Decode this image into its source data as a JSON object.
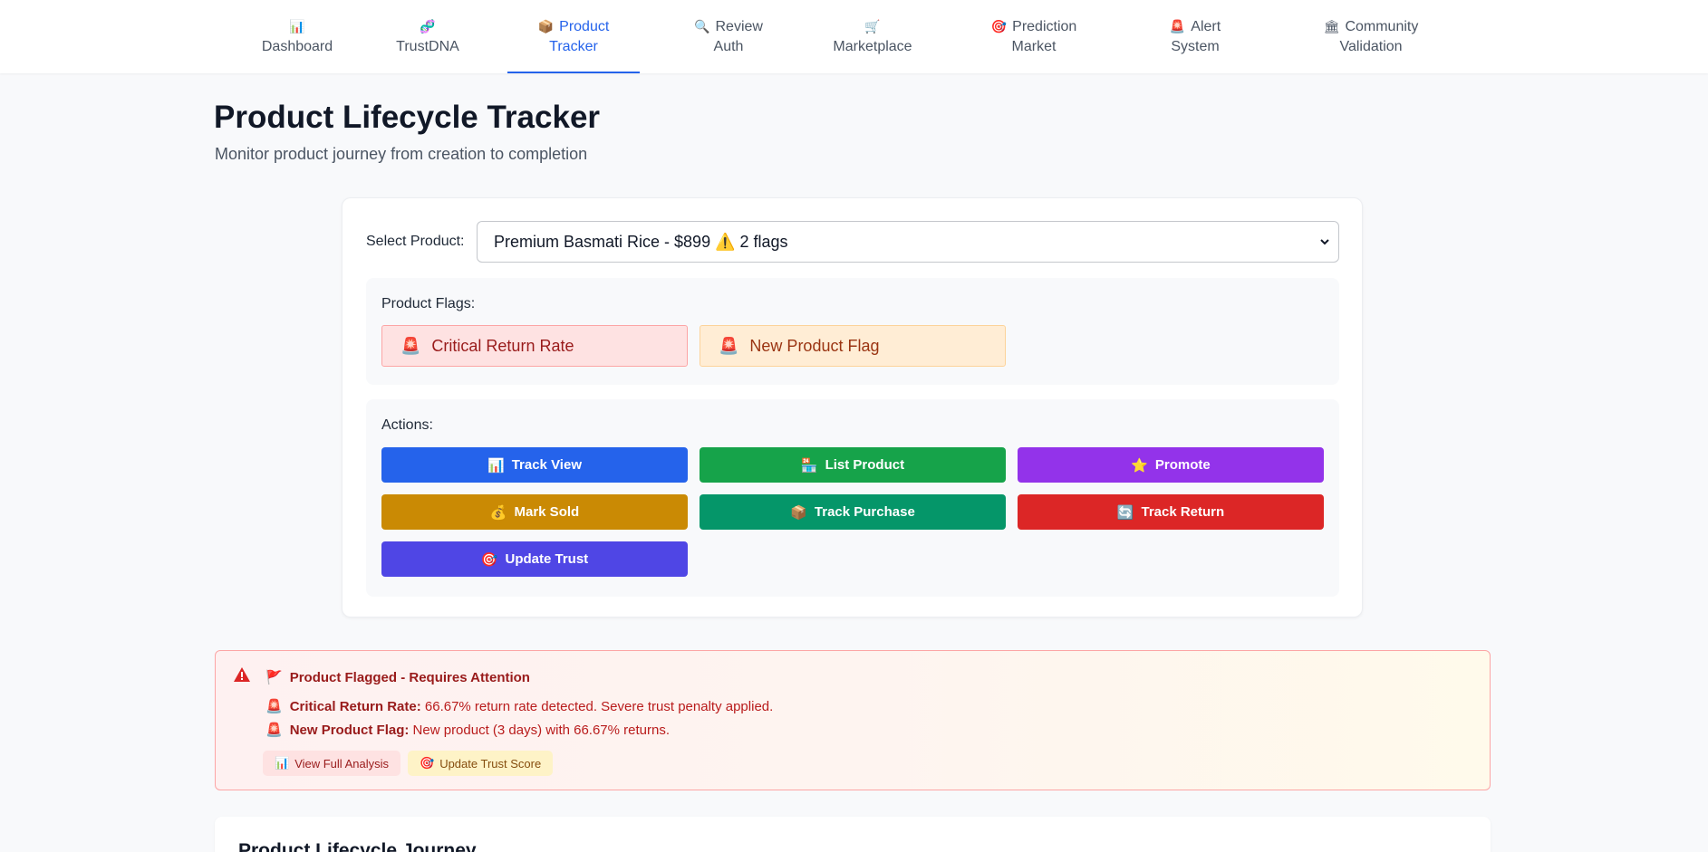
{
  "nav": {
    "tabs": [
      {
        "icon": "📊",
        "line1": "",
        "line2": "Dashboard"
      },
      {
        "icon": "🧬",
        "line1": "",
        "line2": "TrustDNA"
      },
      {
        "icon": "📦",
        "line1": "Product",
        "line2": "Tracker"
      },
      {
        "icon": "🔍",
        "line1": "Review",
        "line2": "Auth"
      },
      {
        "icon": "🛒",
        "line1": "",
        "line2": "Marketplace"
      },
      {
        "icon": "🎯",
        "line1": "Prediction",
        "line2": "Market"
      },
      {
        "icon": "🚨",
        "line1": "Alert",
        "line2": "System"
      },
      {
        "icon": "🏛",
        "line1": "Community",
        "line2": "Validation"
      }
    ],
    "active_index": 2,
    "accent_color": "#2563eb"
  },
  "header": {
    "title": "Product Lifecycle Tracker",
    "subtitle": "Monitor product journey from creation to completion"
  },
  "selector": {
    "label": "Select Product:",
    "selected": "Premium Basmati Rice - $899 ⚠️ 2 flags"
  },
  "flags": {
    "label": "Product Flags:",
    "items": [
      {
        "icon": "🚨",
        "text": "Critical Return Rate"
      },
      {
        "icon": "🚨",
        "text": "New Product Flag"
      }
    ]
  },
  "actions": {
    "label": "Actions:",
    "buttons": [
      {
        "icon": "📊",
        "text": "Track View",
        "color": "#2563eb"
      },
      {
        "icon": "🏪",
        "text": "List Product",
        "color": "#16a34a"
      },
      {
        "icon": "⭐",
        "text": "Promote",
        "color": "#9333ea"
      },
      {
        "icon": "💰",
        "text": "Mark Sold",
        "color": "#ca8a04"
      },
      {
        "icon": "📦",
        "text": "Track Purchase",
        "color": "#059669"
      },
      {
        "icon": "🔄",
        "text": "Track Return",
        "color": "#dc2626"
      },
      {
        "icon": "🎯",
        "text": "Update Trust",
        "color": "#4f46e5"
      }
    ]
  },
  "alert": {
    "title_icon": "🚩",
    "title": "Product Flagged - Requires Attention",
    "lines": [
      {
        "icon": "🚨",
        "label": "Critical Return Rate:",
        "text": "66.67% return rate detected. Severe trust penalty applied."
      },
      {
        "icon": "🚨",
        "label": "New Product Flag:",
        "text": "New product (3 days) with 66.67% returns."
      }
    ],
    "buttons": [
      {
        "icon": "📊",
        "text": "View Full Analysis"
      },
      {
        "icon": "🎯",
        "text": "Update Trust Score"
      }
    ]
  },
  "journey": {
    "title": "Product Lifecycle Journey"
  }
}
